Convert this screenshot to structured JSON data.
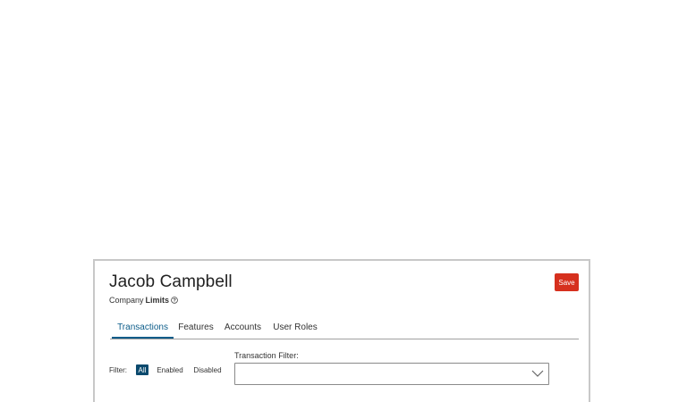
{
  "header": {
    "user_name": "Jacob Campbell",
    "subtitle_prefix": "Company",
    "subtitle_emphasis": "Limits",
    "help_icon": "help-circle-icon",
    "save_label": "Save"
  },
  "tabs": [
    {
      "label": "Transactions",
      "active": true
    },
    {
      "label": "Features",
      "active": false
    },
    {
      "label": "Accounts",
      "active": false
    },
    {
      "label": "User Roles",
      "active": false
    }
  ],
  "filter": {
    "label": "Filter:",
    "options": [
      {
        "label": "All",
        "selected": true
      },
      {
        "label": "Enabled",
        "selected": false
      },
      {
        "label": "Disabled",
        "selected": false
      }
    ]
  },
  "transaction_filter": {
    "label": "Transaction Filter:",
    "value": "",
    "icon": "chevron-down-icon"
  },
  "colors": {
    "accent": "#0d5d8a",
    "save_button": "#d6301e",
    "selected_pill": "#0b4a6e"
  }
}
